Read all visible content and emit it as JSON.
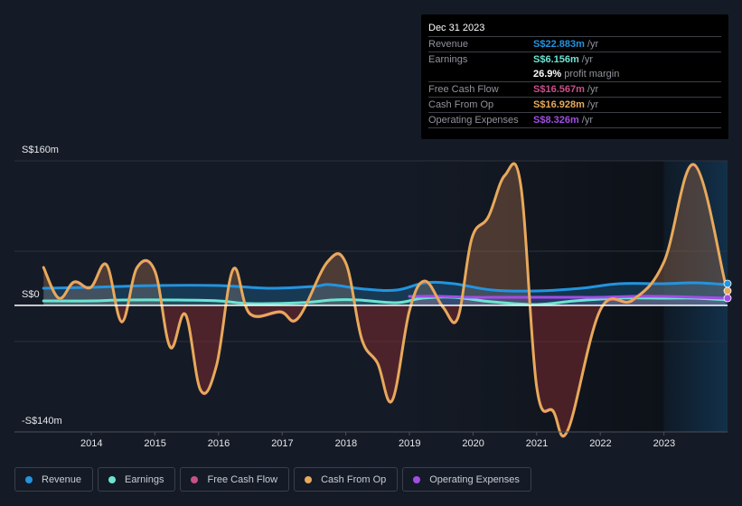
{
  "tooltip": {
    "date": "Dec 31 2023",
    "rows": [
      {
        "label": "Revenue",
        "value": "S$22.883m",
        "unit": "/yr",
        "color": "#2394df"
      },
      {
        "label": "Earnings",
        "value": "S$6.156m",
        "unit": "/yr",
        "color": "#6ce5d3"
      },
      {
        "label": "",
        "value": "26.9%",
        "unit": "profit margin",
        "color": "#ffffff"
      },
      {
        "label": "Free Cash Flow",
        "value": "S$16.567m",
        "unit": "/yr",
        "color": "#c94f8a"
      },
      {
        "label": "Cash From Op",
        "value": "S$16.928m",
        "unit": "/yr",
        "color": "#e8a95b"
      },
      {
        "label": "Operating Expenses",
        "value": "S$8.326m",
        "unit": "/yr",
        "color": "#a24de6"
      }
    ]
  },
  "legend": [
    {
      "label": "Revenue",
      "color": "#2394df"
    },
    {
      "label": "Earnings",
      "color": "#6ce5d3"
    },
    {
      "label": "Free Cash Flow",
      "color": "#c94f8a"
    },
    {
      "label": "Cash From Op",
      "color": "#e8a95b"
    },
    {
      "label": "Operating Expenses",
      "color": "#a24de6"
    }
  ],
  "chart_data": {
    "type": "area",
    "title": "",
    "xlabel": "",
    "ylabel": "",
    "y_tick_labels": [
      "S$160m",
      "S$0",
      "-S$140m"
    ],
    "ylim": [
      -140,
      160
    ],
    "xlim": [
      2013.25,
      2023.99
    ],
    "x_ticks": [
      2014,
      2015,
      2016,
      2017,
      2018,
      2019,
      2020,
      2021,
      2022,
      2023
    ],
    "x_tick_labels": [
      "2014",
      "2015",
      "2016",
      "2017",
      "2018",
      "2019",
      "2020",
      "2021",
      "2022",
      "2023"
    ],
    "grid": true,
    "forecast_region_start": 2023.0,
    "legend_position": "bottom",
    "series": [
      {
        "name": "Revenue",
        "color": "#2394df",
        "x": [
          2013.25,
          2014.0,
          2015.0,
          2016.0,
          2016.8,
          2017.5,
          2017.75,
          2018.3,
          2018.8,
          2019.25,
          2019.7,
          2020.3,
          2021.0,
          2021.7,
          2022.3,
          2023.0,
          2023.5,
          2023.99
        ],
        "y": [
          19,
          20,
          22,
          22,
          19,
          21,
          23,
          18,
          17,
          25,
          24,
          17,
          16,
          19,
          24,
          24,
          25,
          23
        ]
      },
      {
        "name": "Earnings",
        "color": "#6ce5d3",
        "x": [
          2013.25,
          2014.0,
          2014.5,
          2015.3,
          2016.0,
          2016.5,
          2017.3,
          2017.8,
          2018.2,
          2018.8,
          2019.2,
          2019.7,
          2020.3,
          2021.0,
          2021.6,
          2022.3,
          2023.0,
          2023.5,
          2023.99
        ],
        "y": [
          5,
          5,
          6,
          6,
          5,
          2,
          3,
          6,
          6,
          3,
          8,
          9,
          4,
          1,
          5,
          8,
          8,
          8,
          6
        ]
      },
      {
        "name": "Free Cash Flow",
        "color": "#c94f8a",
        "x": [
          2013.25,
          2013.49,
          2013.73,
          2013.99,
          2014.24,
          2014.48,
          2014.72,
          2015.0,
          2015.24,
          2015.48,
          2015.72,
          2015.97,
          2016.23,
          2016.49,
          2016.97,
          2017.25,
          2017.71,
          2018.0,
          2018.25,
          2018.5,
          2018.73,
          2019.0,
          2019.24,
          2019.53,
          2019.76,
          2019.98,
          2020.24,
          2020.5,
          2020.75,
          2021.0,
          2021.26,
          2021.49,
          2022.0,
          2022.51,
          2023.0,
          2023.47,
          2023.96
        ],
        "y": [
          41,
          7,
          25,
          19,
          44,
          -19,
          41,
          37,
          -47,
          -11,
          -95,
          -67,
          39,
          -10,
          -8,
          -15,
          47,
          46,
          -38,
          -65,
          -106,
          -7,
          26,
          -3,
          -15,
          73,
          97,
          143,
          132,
          -91,
          -118,
          -139,
          -6,
          5,
          47,
          155,
          25
        ]
      },
      {
        "name": "Cash From Op",
        "color": "#e8a95b",
        "x": [
          2013.25,
          2013.49,
          2013.73,
          2013.99,
          2014.24,
          2014.48,
          2014.72,
          2015.0,
          2015.24,
          2015.48,
          2015.72,
          2015.97,
          2016.23,
          2016.49,
          2016.97,
          2017.25,
          2017.71,
          2018.0,
          2018.25,
          2018.5,
          2018.73,
          2019.0,
          2019.24,
          2019.53,
          2019.76,
          2019.98,
          2020.24,
          2020.5,
          2020.75,
          2021.0,
          2021.26,
          2021.49,
          2022.0,
          2022.51,
          2023.0,
          2023.47,
          2023.96
        ],
        "y": [
          42,
          8,
          26,
          20,
          45,
          -18,
          42,
          38,
          -46,
          -10,
          -94,
          -66,
          40,
          -9,
          -7,
          -14,
          48,
          47,
          -37,
          -64,
          -105,
          -6,
          27,
          -2,
          -14,
          74,
          98,
          144,
          133,
          -90,
          -117,
          -138,
          -5,
          6,
          48,
          156,
          26
        ]
      },
      {
        "name": "Operating Expenses",
        "color": "#a24de6",
        "x": [
          2019.0,
          2019.5,
          2020.0,
          2020.5,
          2021.0,
          2021.5,
          2022.0,
          2022.5,
          2023.0,
          2023.5,
          2023.99
        ],
        "y": [
          10,
          10,
          9,
          9,
          9,
          9,
          9,
          10,
          10,
          9,
          8
        ]
      }
    ]
  }
}
